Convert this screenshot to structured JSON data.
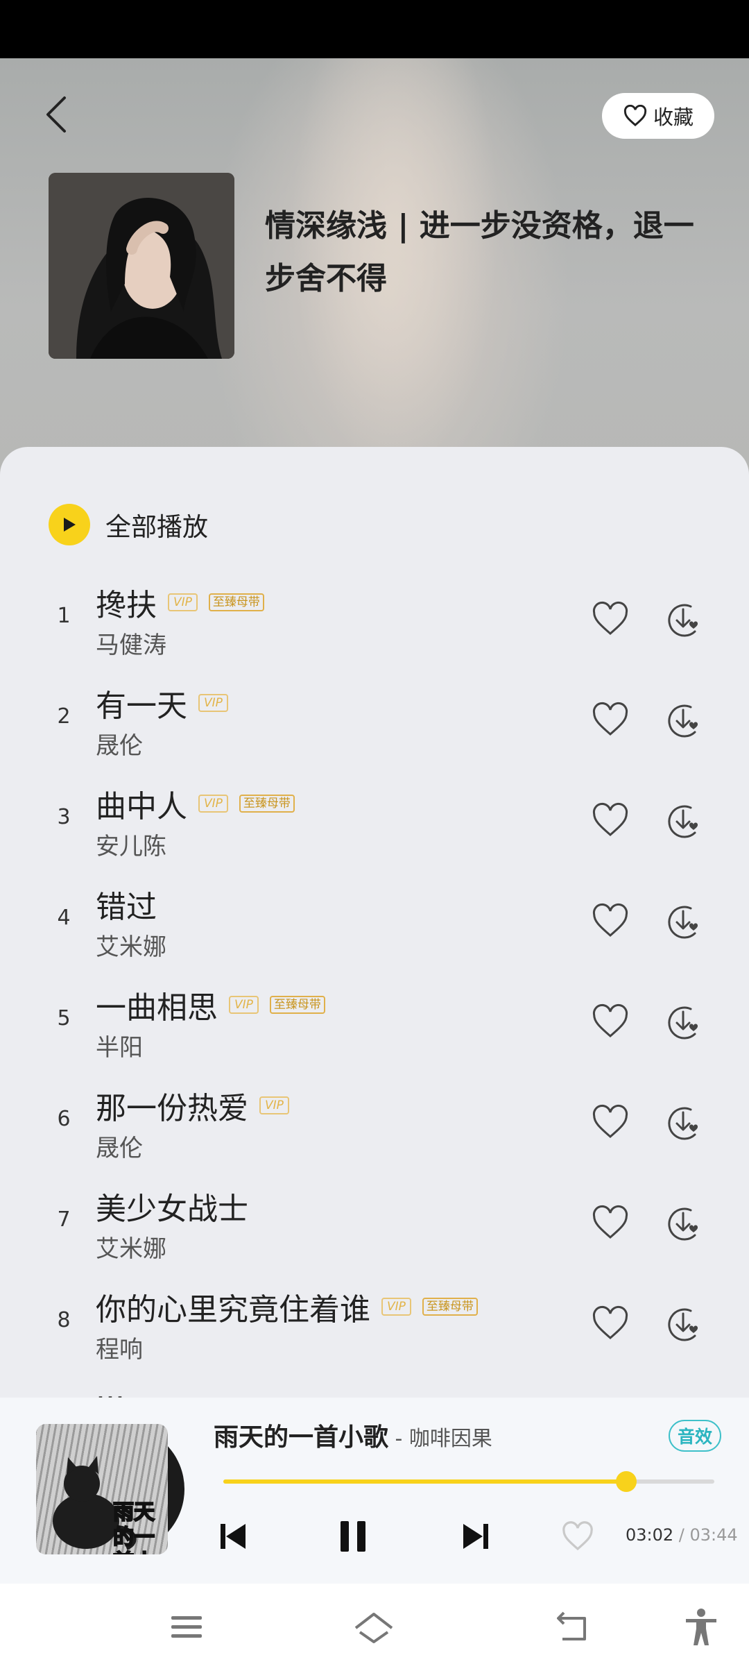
{
  "header": {
    "favorite_label": "收藏",
    "playlist_title": "情深缘浅 | 进一步没资格，退一步舍不得"
  },
  "play_all_label": "全部播放",
  "songs": [
    {
      "index": "1",
      "title": "搀扶",
      "artist": "马健涛",
      "vip": "VIP",
      "master": "至臻母带"
    },
    {
      "index": "2",
      "title": "有一天",
      "artist": "晟伦",
      "vip": "VIP",
      "master": ""
    },
    {
      "index": "3",
      "title": "曲中人",
      "artist": "安儿陈",
      "vip": "VIP",
      "master": "至臻母带"
    },
    {
      "index": "4",
      "title": "错过",
      "artist": "艾米娜",
      "vip": "",
      "master": ""
    },
    {
      "index": "5",
      "title": "一曲相思",
      "artist": "半阳",
      "vip": "VIP",
      "master": "至臻母带"
    },
    {
      "index": "6",
      "title": "那一份热爱",
      "artist": "晟伦",
      "vip": "VIP",
      "master": ""
    },
    {
      "index": "7",
      "title": "美少女战士",
      "artist": "艾米娜",
      "vip": "",
      "master": ""
    },
    {
      "index": "8",
      "title": "你的心里究竟住着谁",
      "artist": "程响",
      "vip": "VIP",
      "master": "至臻母带"
    }
  ],
  "player": {
    "song_title": "雨天的一首小歌",
    "artist_sep": " - 咖啡因果",
    "album_art_text": "雨天的一首小歌",
    "effect_label": "音效",
    "current_time": "03:02",
    "separator": " / ",
    "duration": "03:44",
    "progress": 0.82
  },
  "colors": {
    "accent": "#f8d21b",
    "effect": "#2bb5c0",
    "badge": "#e2b449"
  },
  "icons": {
    "back": "chevron-left-icon",
    "favorite": "heart-outline-icon",
    "play_all": "play-icon",
    "like": "heart-outline-icon",
    "download": "download-icon",
    "prev": "skip-previous-icon",
    "pause": "pause-icon",
    "next": "skip-next-icon",
    "nav_menu": "menu-icon",
    "nav_home": "home-icon",
    "nav_back": "back-icon",
    "nav_accessibility": "accessibility-icon"
  }
}
